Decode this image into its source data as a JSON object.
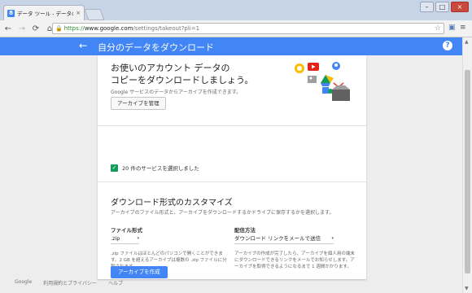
{
  "browser": {
    "tab_title": "データ ツール - データのダウ",
    "tab_favicon": "8",
    "tab_close": "×",
    "url_scheme": "https://",
    "url_host": "www.google.com",
    "url_path": "/settings/takeout?pli=1",
    "minimize": "–",
    "maximize": "□",
    "close": "×"
  },
  "appbar": {
    "title": "自分のデータをダウンロード",
    "back": "←",
    "help": "?"
  },
  "hero": {
    "title": "お使いのアカウント データの\nコピーをダウンロードしましょう。",
    "subtitle": "Google サービスのデータからアーカイブを作成できます。",
    "manage_button": "アーカイブを管理"
  },
  "services": {
    "selected_label": "20 件のサービスを選択しました",
    "checked": "✓"
  },
  "customize": {
    "title": "ダウンロード形式のカスタマイズ",
    "description": "アーカイブのファイル形式と、アーカイブをダウンロードするかドライブに保存するかを選択します。",
    "file_format_label": "ファイル形式",
    "file_format_value": ".zip",
    "file_format_help": ".zip ファイルはほとんどのパソコンで開くことができます。2 GB を超えるアーカイブは複数の .zip ファイルに分割されます。",
    "delivery_label": "配信方法",
    "delivery_value": "ダウンロード リンクをメールで送信",
    "delivery_help": "アーカイブの作成が完了したら、アーカイブを個人用の端末にダウンロードできるリンクをメールでお知らせします。アーカイブを取得できるようになるまで 1 週間かかります。",
    "create_button": "アーカイブを作成"
  },
  "footer": {
    "links": [
      "Google",
      "利用規約とプライバシー",
      "ヘルプ"
    ]
  },
  "colors": {
    "appbar": "#4285f4",
    "check": "#0f9d58",
    "primary_button": "#4285f4"
  }
}
